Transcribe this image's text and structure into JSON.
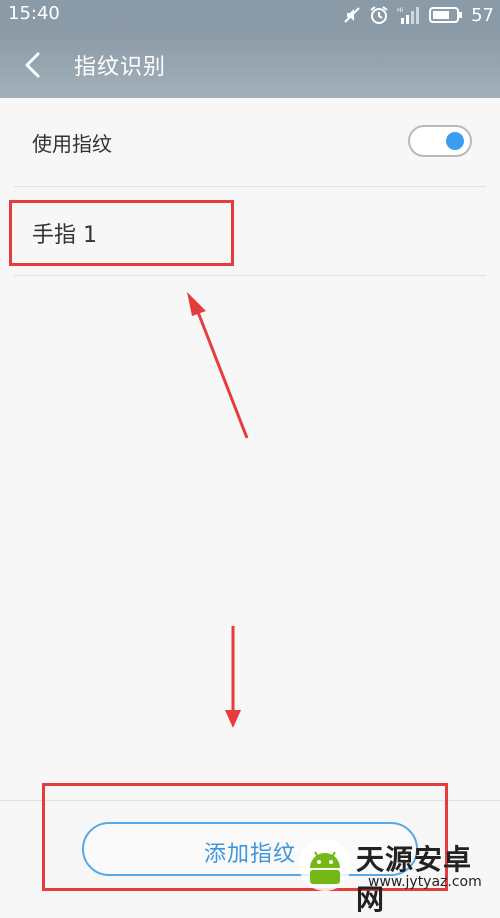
{
  "status_bar": {
    "time": "15:40",
    "battery": "57"
  },
  "header": {
    "title": "指纹识别"
  },
  "settings": {
    "use_fingerprint_label": "使用指纹",
    "use_fingerprint_on": true,
    "fingerprints": [
      {
        "label": "手指 1"
      }
    ]
  },
  "footer": {
    "add_button_label": "添加指纹"
  },
  "watermark": {
    "title": "天源安卓网",
    "url": "www.jytyaz.com"
  },
  "colors": {
    "toggle_on": "#3a9df0",
    "highlight": "#e53d3d",
    "accent": "#3e97dc",
    "header": "#8a9aa6"
  },
  "icons": [
    "back-arrow-icon",
    "mute-icon",
    "alarm-icon",
    "signal-icon",
    "battery-icon"
  ]
}
